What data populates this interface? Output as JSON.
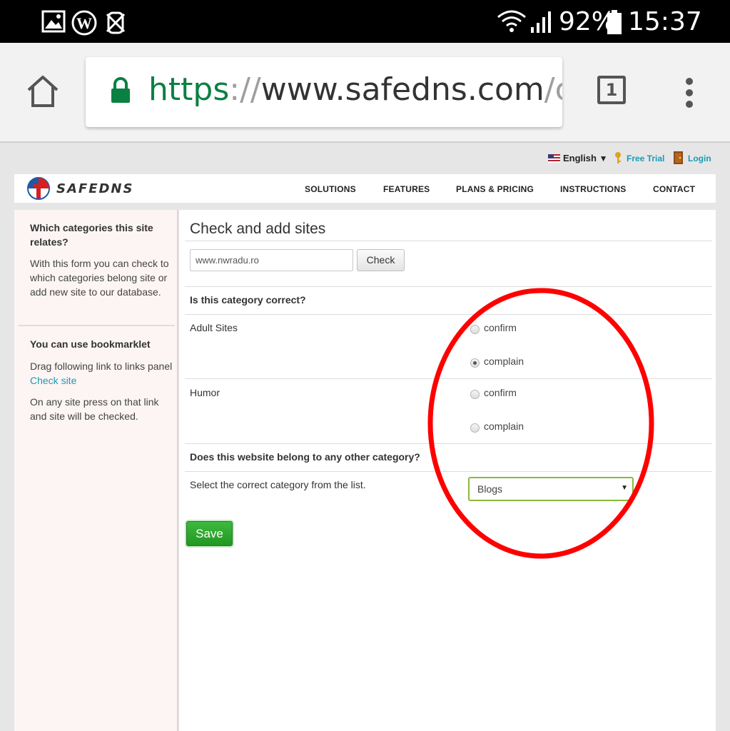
{
  "status_bar": {
    "battery": "92%",
    "time": "15:37",
    "icons": [
      "image-icon",
      "wordpress-icon",
      "vpn-icon",
      "wifi-icon",
      "signal-icon",
      "battery-icon"
    ]
  },
  "browser": {
    "url_scheme": "https",
    "url_sep": "://",
    "url_host": "www.safedns.com",
    "url_path": "/ch",
    "tab_count": "1"
  },
  "top_links": {
    "language": "English",
    "free_trial": "Free Trial",
    "login": "Login"
  },
  "nav": {
    "logo": "SAFEDNS",
    "items": [
      "SOLUTIONS",
      "FEATURES",
      "PLANS & PRICING",
      "INSTRUCTIONS",
      "CONTACT"
    ]
  },
  "sidebar": {
    "title1": "Which categories this site relates?",
    "desc1": "With this form you can check to which categories belong site or add new site to our database.",
    "title2": "You can use bookmarklet",
    "desc2_prefix": "Drag following link to links panel ",
    "desc2_link": "Check site",
    "desc3": "On any site press on that link and site will be checked."
  },
  "main": {
    "heading": "Check and add sites",
    "site_value": "www.nwradu.ro",
    "check_label": "Check",
    "question1": "Is this category correct?",
    "categories": [
      {
        "name": "Adult Sites",
        "options": [
          "confirm",
          "complain"
        ],
        "selected": "complain"
      },
      {
        "name": "Humor",
        "options": [
          "confirm",
          "complain"
        ],
        "selected": ""
      }
    ],
    "question2": "Does this website belong to any other category?",
    "select_prompt": "Select the correct category from the list.",
    "select_value": "Blogs",
    "save_label": "Save"
  },
  "colors": {
    "link": "#1a9bb5",
    "save_button": "#2ea62e",
    "select_border": "#8db83a",
    "annotation_circle": "#ff0000"
  }
}
